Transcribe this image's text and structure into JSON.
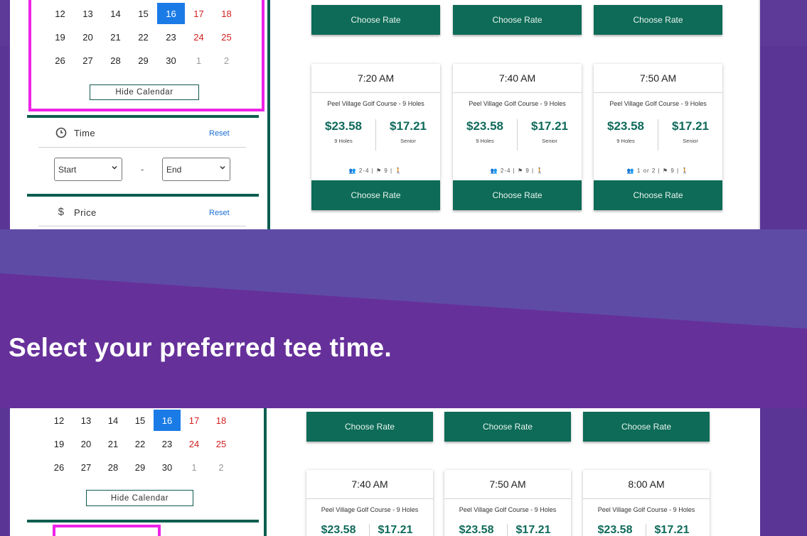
{
  "calendar": {
    "rows": [
      [
        "12",
        "13",
        "14",
        "15",
        "16",
        "17",
        "18"
      ],
      [
        "19",
        "20",
        "21",
        "22",
        "23",
        "24",
        "25"
      ],
      [
        "26",
        "27",
        "28",
        "29",
        "30",
        "1",
        "2"
      ]
    ],
    "selected_day": "16",
    "hide_label": "Hide Calendar"
  },
  "filters": {
    "time_label": "Time",
    "reset_label": "Reset",
    "start_value": "Start",
    "end_value": "End",
    "price_label": "Price"
  },
  "rate_cards_top": [
    {
      "time": "7:20 AM",
      "course": "Peel Village Golf Course - 9 Holes",
      "price1": "$23.58",
      "label1": "9 Holes",
      "price2": "$17.21",
      "label2": "Senior",
      "players": "2-4",
      "holes": "9"
    },
    {
      "time": "7:40 AM",
      "course": "Peel Village Golf Course - 9 Holes",
      "price1": "$23.58",
      "label1": "9 Holes",
      "price2": "$17.21",
      "label2": "Senior",
      "players": "2-4",
      "holes": "9"
    },
    {
      "time": "7:50 AM",
      "course": "Peel Village Golf Course - 9 Holes",
      "price1": "$23.58",
      "label1": "9 Holes",
      "price2": "$17.21",
      "label2": "Senior",
      "players": "1 or 2",
      "holes": "9"
    }
  ],
  "rate_cards_bottom": [
    {
      "time": "7:40 AM",
      "course": "Peel Village Golf Course - 9 Holes",
      "price1": "$23.58",
      "price2": "$17.21"
    },
    {
      "time": "7:50 AM",
      "course": "Peel Village Golf Course - 9 Holes",
      "price1": "$23.58",
      "price2": "$17.21"
    },
    {
      "time": "8:00 AM",
      "course": "Peel Village Golf Course - 9 Holes",
      "price1": "$23.58",
      "price2": "$17.21"
    }
  ],
  "choose_rate_label": "Choose Rate",
  "tagline": "Select your preferred tee time.",
  "colors": {
    "purple": "#5d3a98",
    "green": "#0d6b57",
    "magenta_highlight": "#ee22e8",
    "selected_blue": "#1a7be6",
    "weekend_red": "#d21f1f",
    "price_green": "#0f6a5a"
  }
}
